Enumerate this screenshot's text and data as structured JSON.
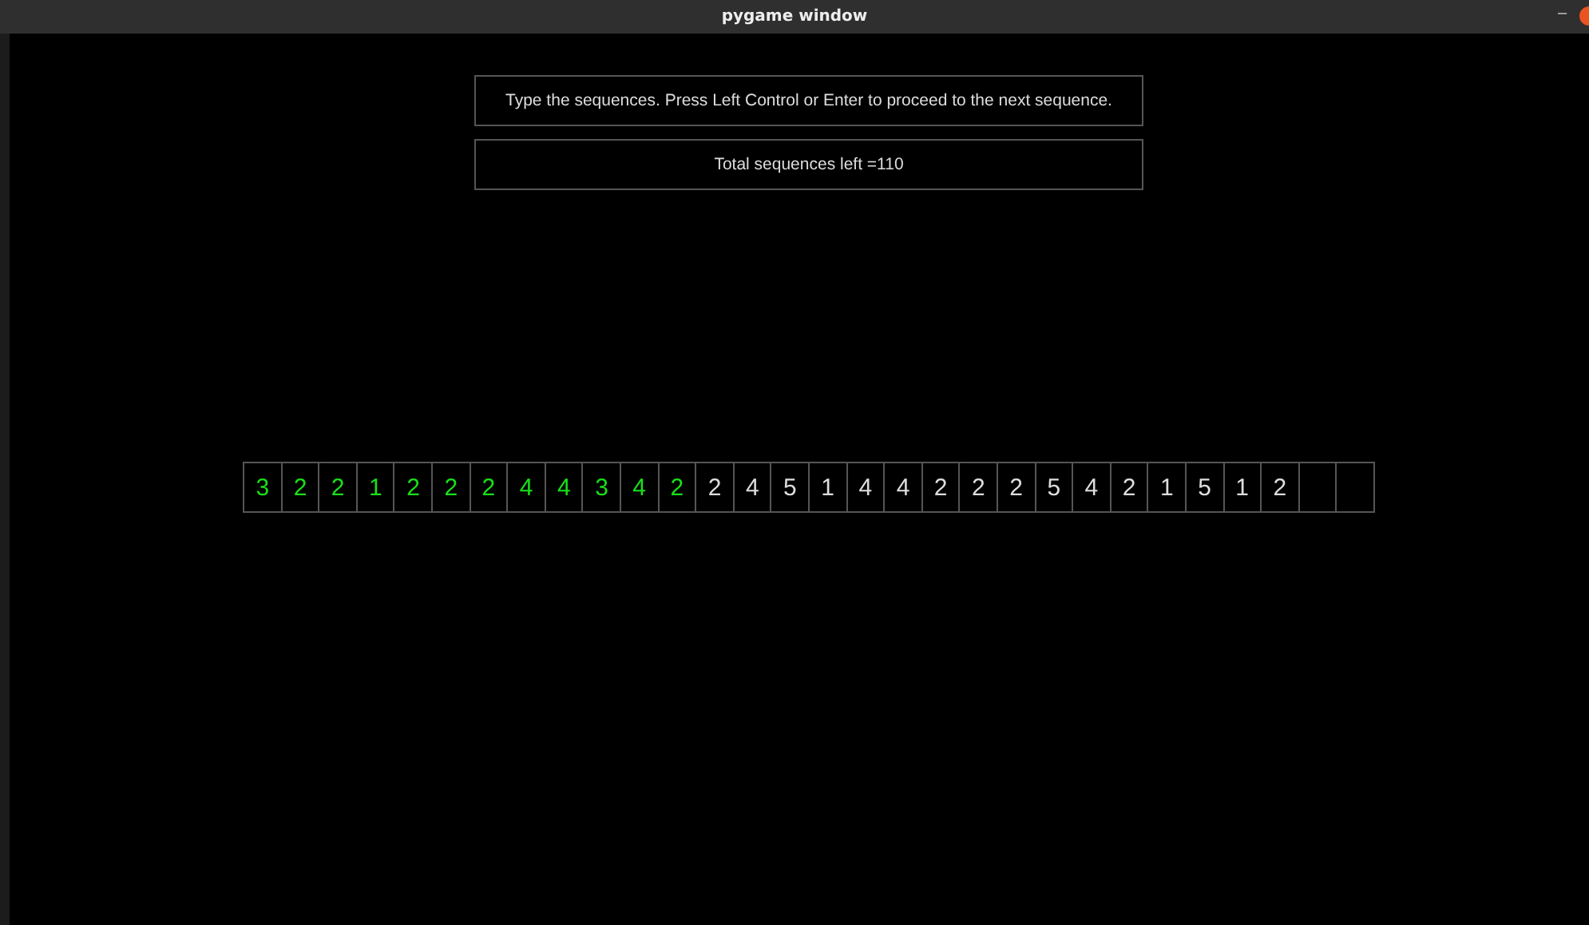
{
  "window": {
    "title": "pygame window",
    "minimize": "–"
  },
  "instructions": "Type the sequences. Press Left Control or Enter to proceed to the next sequence.",
  "counter": "Total sequences left =110",
  "cells": [
    {
      "kind": "digit",
      "text": "3",
      "typed": true
    },
    {
      "kind": "digit",
      "text": "2",
      "typed": true
    },
    {
      "kind": "digit",
      "text": "2",
      "typed": true
    },
    {
      "kind": "digit",
      "text": "1",
      "typed": true
    },
    {
      "kind": "digit",
      "text": "2",
      "typed": true
    },
    {
      "kind": "digit",
      "text": "2",
      "typed": true
    },
    {
      "kind": "digit",
      "text": "2",
      "typed": true
    },
    {
      "kind": "digit",
      "text": "4",
      "typed": true
    },
    {
      "kind": "digit",
      "text": "4",
      "typed": true
    },
    {
      "kind": "digit",
      "text": "3",
      "typed": true
    },
    {
      "kind": "digit",
      "text": "4",
      "typed": true
    },
    {
      "kind": "digit",
      "text": "2",
      "typed": true
    },
    {
      "kind": "digit",
      "text": "2",
      "typed": false
    },
    {
      "kind": "digit",
      "text": "4",
      "typed": false
    },
    {
      "kind": "digit",
      "text": "5",
      "typed": false
    },
    {
      "kind": "digit",
      "text": "1",
      "typed": false
    },
    {
      "kind": "digit",
      "text": "4",
      "typed": false
    },
    {
      "kind": "digit",
      "text": "4",
      "typed": false
    },
    {
      "kind": "digit",
      "text": "2",
      "typed": false
    },
    {
      "kind": "digit",
      "text": "2",
      "typed": false
    },
    {
      "kind": "digit",
      "text": "2",
      "typed": false
    },
    {
      "kind": "digit",
      "text": "5",
      "typed": false
    },
    {
      "kind": "digit",
      "text": "4",
      "typed": false
    },
    {
      "kind": "digit",
      "text": "2",
      "typed": false
    },
    {
      "kind": "digit",
      "text": "1",
      "typed": false
    },
    {
      "kind": "digit",
      "text": "5",
      "typed": false
    },
    {
      "kind": "digit",
      "text": "1",
      "typed": false
    },
    {
      "kind": "digit",
      "text": "2",
      "typed": false
    },
    {
      "kind": "empty"
    },
    {
      "kind": "empty"
    }
  ]
}
